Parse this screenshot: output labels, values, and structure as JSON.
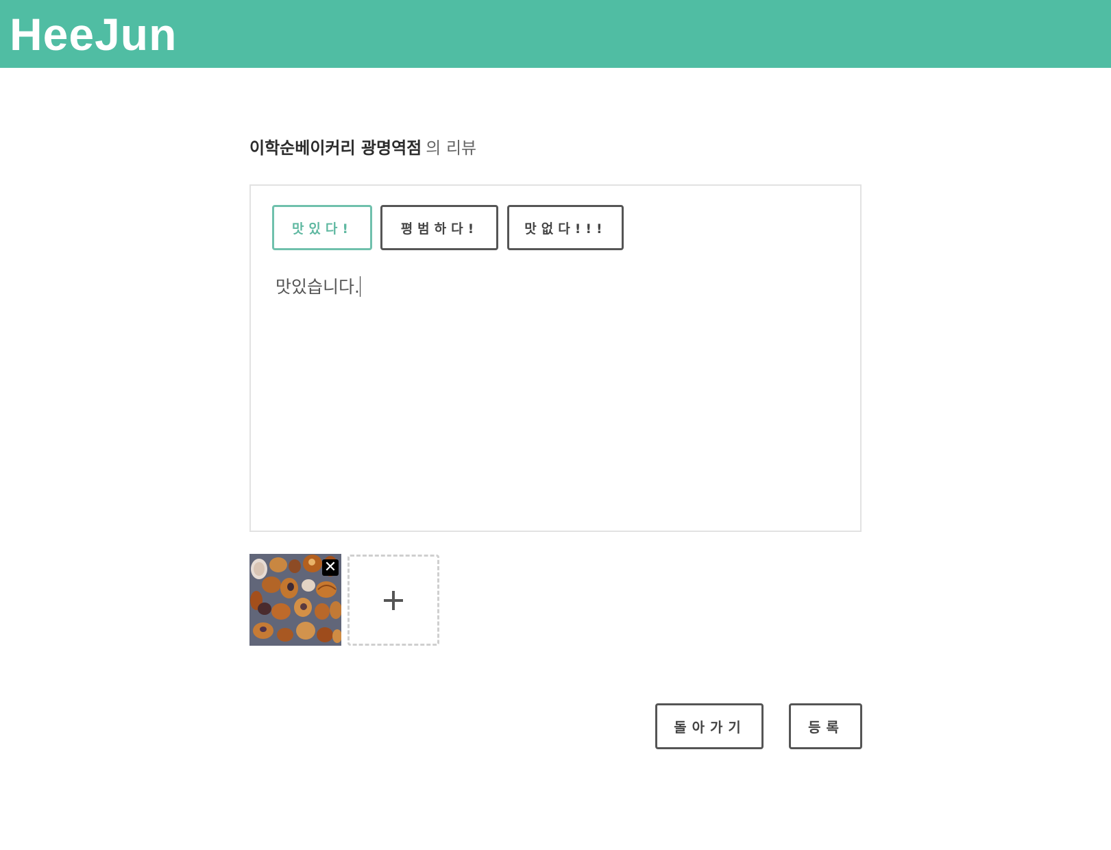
{
  "header": {
    "logo": "HeeJun",
    "color": "#50bda3"
  },
  "review": {
    "store_name": "이학순베이커리 광명역점",
    "title_suffix": "의 리뷰",
    "ratings": [
      {
        "label": "맛있다!",
        "selected": true
      },
      {
        "label": "평범하다!",
        "selected": false
      },
      {
        "label": "맛없다!!!",
        "selected": false
      }
    ],
    "content": "맛있습니다.",
    "photos": [
      {
        "icon": "pastry-photo",
        "remove_label": "✕"
      }
    ],
    "add_photo_icon": "plus-icon"
  },
  "actions": {
    "back_label": "돌아가기",
    "submit_label": "등록"
  }
}
